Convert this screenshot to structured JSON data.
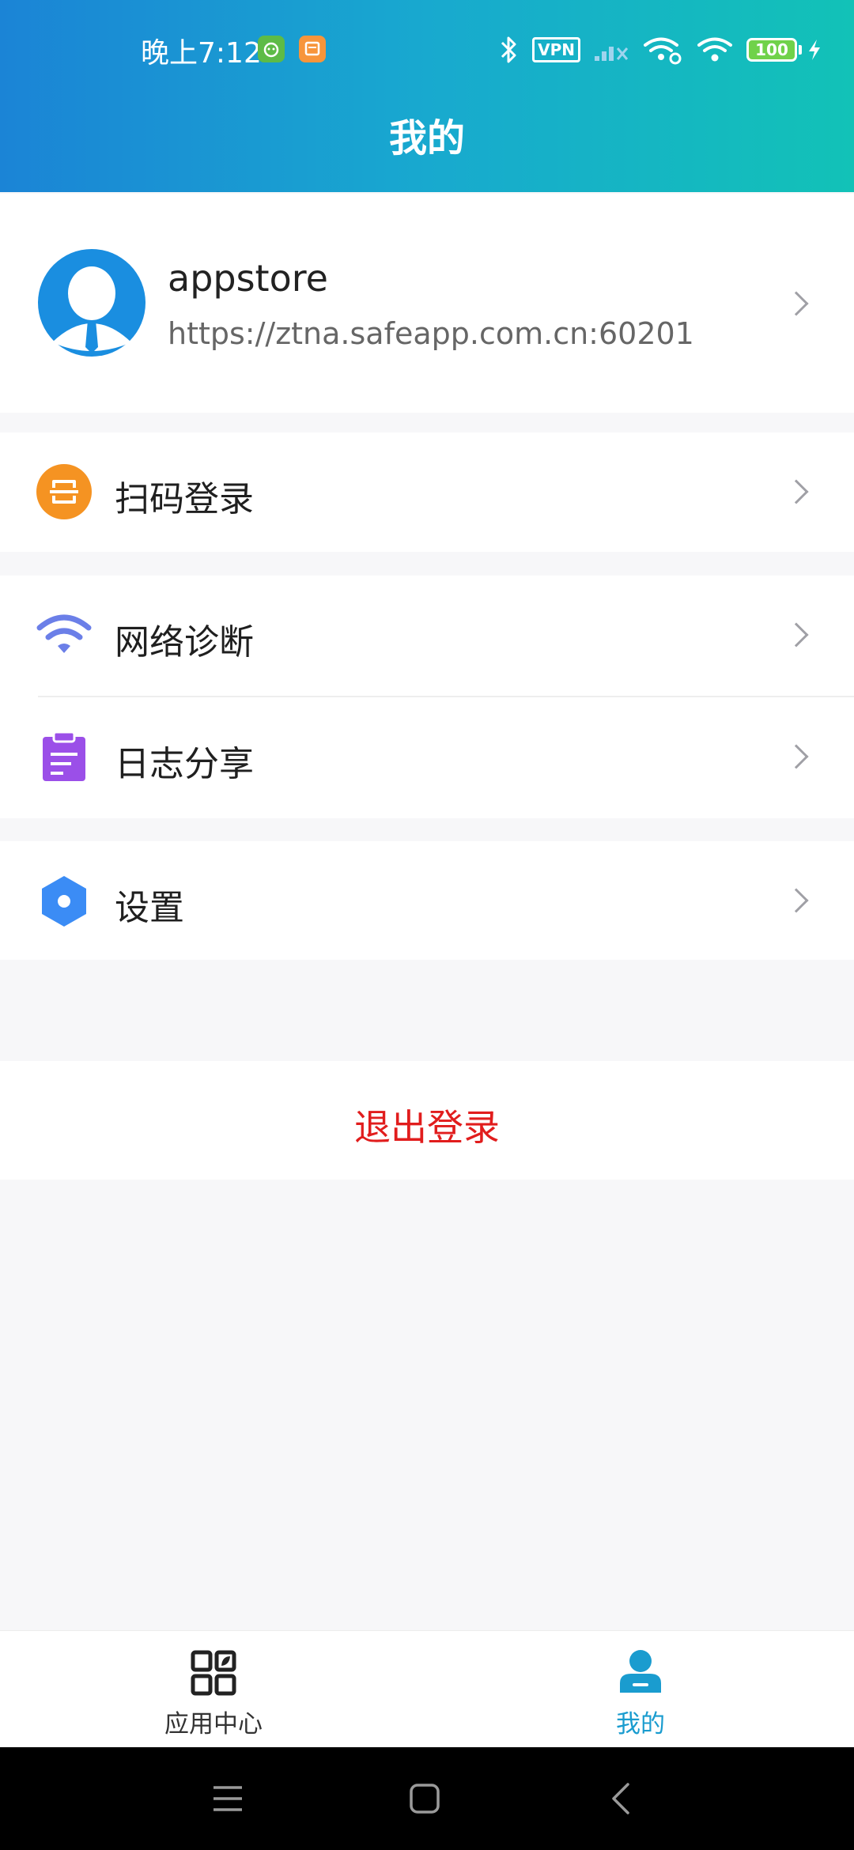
{
  "status_bar": {
    "time": "晚上7:12",
    "vpn_label": "VPN",
    "battery": "100"
  },
  "header": {
    "title": "我的"
  },
  "profile": {
    "username": "appstore",
    "server_url": "https://ztna.safeapp.com.cn:60201"
  },
  "menu": {
    "scan_login": "扫码登录",
    "network_diagnosis": "网络诊断",
    "log_share": "日志分享",
    "settings": "设置"
  },
  "logout_label": "退出登录",
  "tabbar": {
    "app_center": "应用中心",
    "mine": "我的"
  },
  "colors": {
    "accent": "#1a9ccf",
    "logout": "#e11d1d",
    "scan_icon": "#f59322",
    "wifi_icon": "#6b7fe8",
    "log_icon": "#9b4fe8",
    "settings_icon": "#3b8cf5"
  }
}
